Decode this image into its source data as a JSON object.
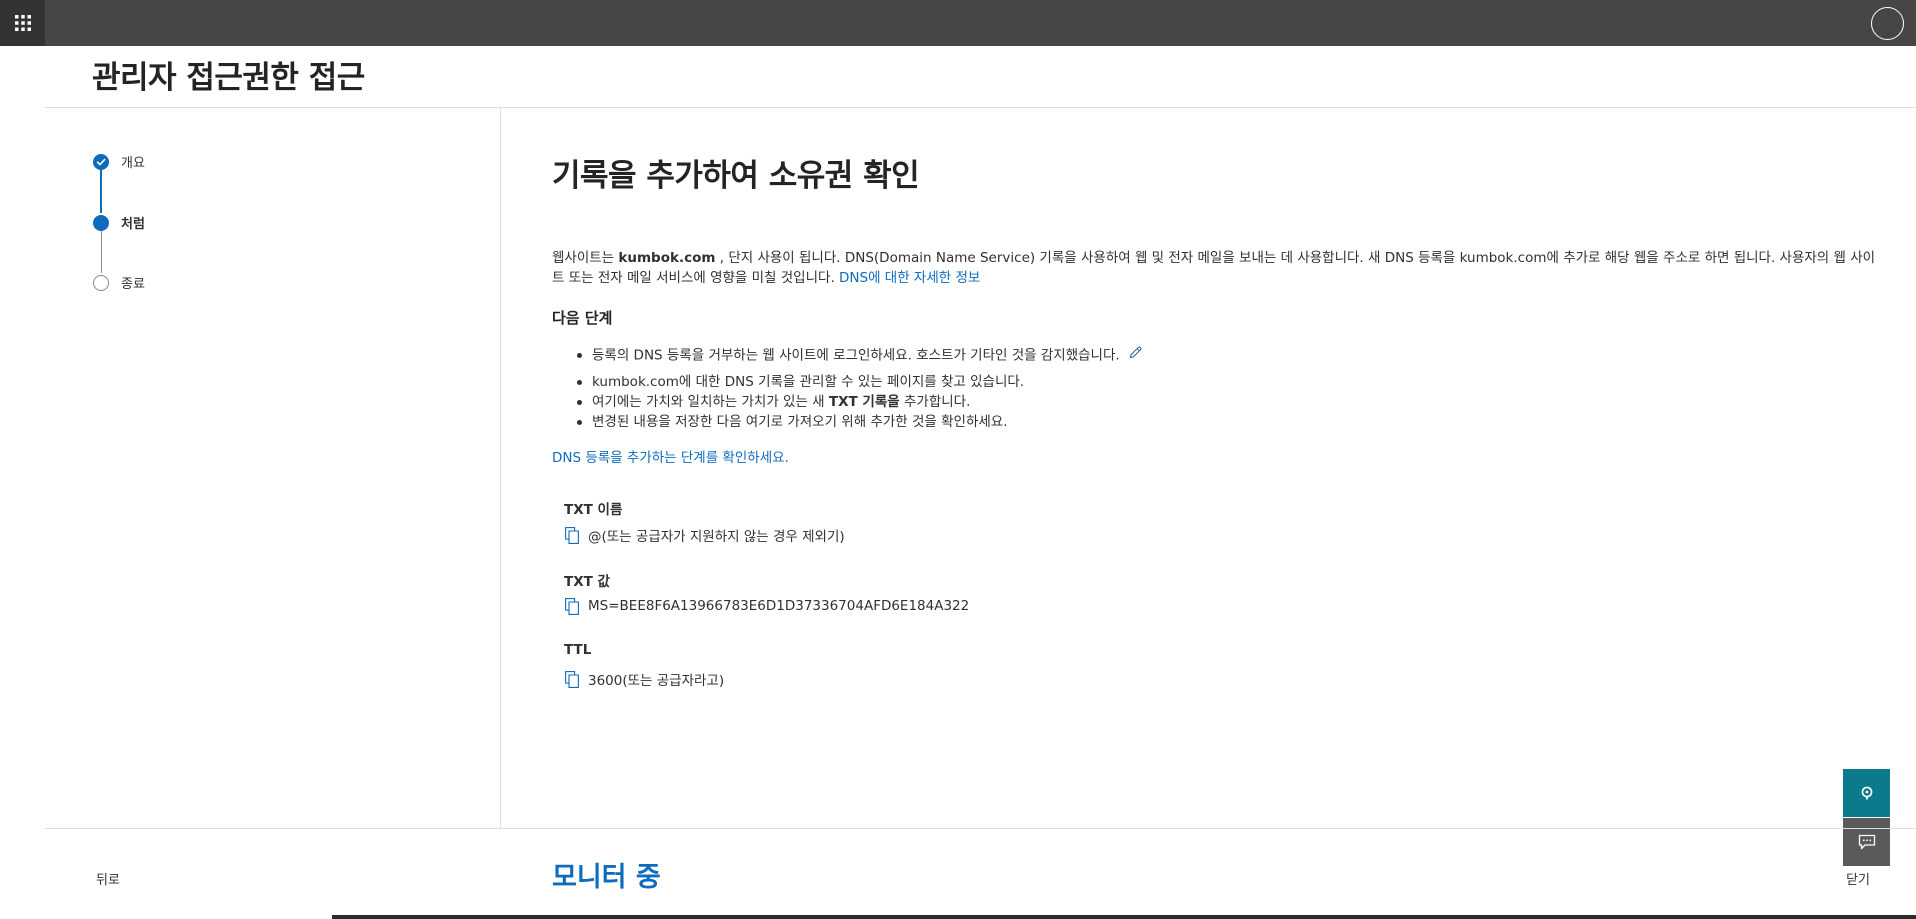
{
  "page": {
    "title": "관리자 접근권한 접근"
  },
  "progress": {
    "steps": [
      {
        "label": "개요",
        "state": "complete"
      },
      {
        "label": "처럼",
        "state": "current"
      },
      {
        "label": "종료",
        "state": "pending"
      }
    ]
  },
  "main": {
    "heading": "기록을 추가하여 소유권 확인",
    "intro": {
      "part1": "웹사이트는 ",
      "domain_bold": "kumbok.com",
      "part2": " , 단지 사용이 됩니다. DNS(Domain Name Service) 기록을 사용하여 웹 및 전자 메일을 보내는 데 사용합니다. 새 DNS 등록을 kumbok.com에 추가로 해당 웹을 주소로 하면 됩니다. 사용자의 웹 사이트 또는 전자 메일 서비스에 영향을 미칠 것입니다. ",
      "learn_more_link": "DNS에 대한 자세한 정보"
    },
    "next_steps_title": "다음 단계",
    "next_steps": {
      "item1": "등록의 DNS 등록을 거부하는 웹 사이트에 로그인하세요. 호스트가 기타인 것을 감지했습니다.",
      "item2": "kumbok.com에 대한 DNS 기록을 관리할 수 있는 페이지를 찾고 있습니다.",
      "item3_pre": "여기에는 가치와 일치하는 가치가 있는 새 ",
      "item3_bold": "TXT 기록을",
      "item3_post": " 추가합니다.",
      "item4": "변경된 내용을 저장한 다음 여기로 가져오기 위해 추가한 것을 확인하세요."
    },
    "dns_steps_link": "DNS 등록을 추가하는 단계를 확인하세요.",
    "fields": [
      {
        "label": "TXT 이름",
        "value": "@(또는 공급자가 지원하지 않는 경우 제외기)"
      },
      {
        "label": "TXT 값",
        "value": "MS=BEE8F6A13966783E6D1D37336704AFD6E184A322"
      },
      {
        "label": "TTL",
        "value": "3600(또는 공급자라고)"
      }
    ]
  },
  "footer": {
    "back_label": "뒤로",
    "status": "모니터 중",
    "close_label": "닫기"
  },
  "colors": {
    "accent": "#0f6cbd",
    "topbar": "#464646",
    "help_button": "#0b7a8a",
    "feedback_button": "#5a5a5a"
  },
  "icons": {
    "app_launcher": "waffle-icon",
    "account": "avatar-icon",
    "step_complete": "checkmark-icon",
    "edit": "pencil-icon",
    "copy": "copy-icon",
    "help": "help-icon",
    "feedback": "feedback-icon"
  }
}
